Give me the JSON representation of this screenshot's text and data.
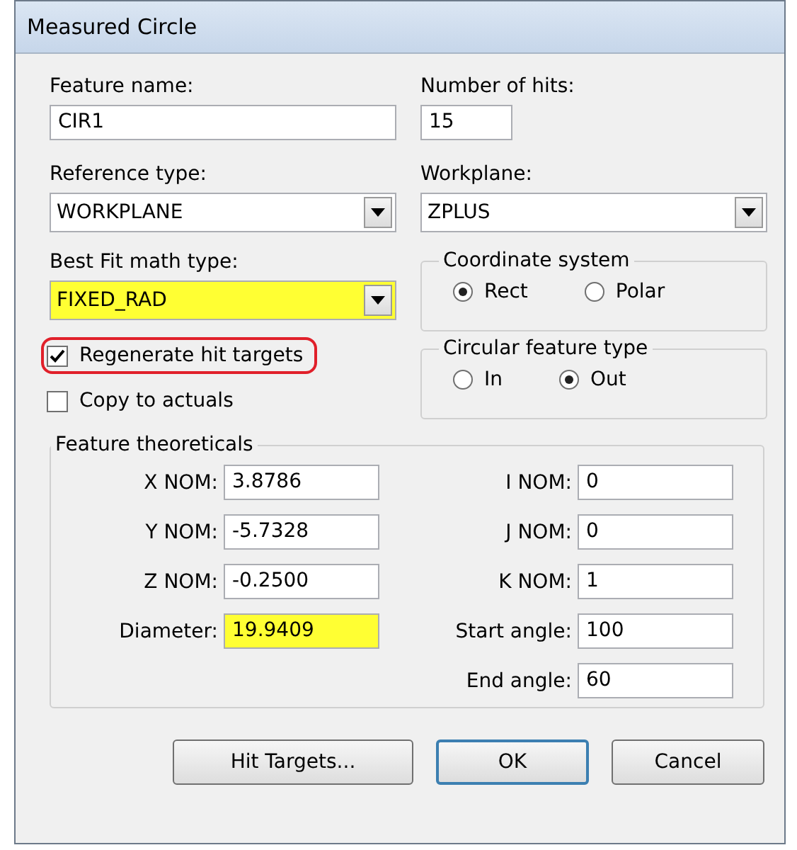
{
  "window": {
    "title": "Measured Circle"
  },
  "left_fields": [
    {
      "kind": "text",
      "label": "Feature name:",
      "value": "CIR1",
      "highlighted": false
    },
    {
      "kind": "dropdown",
      "label": "Reference type:",
      "value": "WORKPLANE",
      "highlighted": false
    },
    {
      "kind": "dropdown",
      "label": "Best Fit math type:",
      "value": "FIXED_RAD",
      "highlighted": true
    }
  ],
  "right_fields": [
    {
      "kind": "short_text",
      "label": "Number of hits:",
      "value": "15",
      "highlighted": false
    },
    {
      "kind": "dropdown",
      "label": "Workplane:",
      "value": "ZPLUS",
      "highlighted": false
    }
  ],
  "checkboxes": [
    {
      "label": "Regenerate hit targets",
      "checked": true,
      "outlined": true
    },
    {
      "label": "Copy to actuals",
      "checked": false,
      "outlined": false
    }
  ],
  "radio_groups": [
    {
      "title": "Coordinate system",
      "options": [
        {
          "label": "Rect",
          "selected": true
        },
        {
          "label": "Polar",
          "selected": false
        }
      ]
    },
    {
      "title": "Circular feature type",
      "options": [
        {
          "label": "In",
          "selected": false
        },
        {
          "label": "Out",
          "selected": true
        }
      ]
    }
  ],
  "theoreticals": {
    "title": "Feature theoreticals",
    "left": [
      {
        "label": "X NOM:",
        "value": "3.8786",
        "highlighted": false
      },
      {
        "label": "Y NOM:",
        "value": "-5.7328",
        "highlighted": false
      },
      {
        "label": "Z NOM:",
        "value": "-0.2500",
        "highlighted": false
      },
      {
        "label": "Diameter:",
        "value": "19.9409",
        "highlighted": true
      }
    ],
    "right": [
      {
        "label": "I NOM:",
        "value": "0",
        "highlighted": false
      },
      {
        "label": "J NOM:",
        "value": "0",
        "highlighted": false
      },
      {
        "label": "K NOM:",
        "value": "1",
        "highlighted": false
      },
      {
        "label": "Start angle:",
        "value": "100",
        "highlighted": false
      },
      {
        "label": "End angle:",
        "value": "60",
        "highlighted": false
      }
    ]
  },
  "buttons": [
    {
      "label": "Hit Targets...",
      "default": false
    },
    {
      "label": "OK",
      "default": true
    },
    {
      "label": "Cancel",
      "default": false
    }
  ]
}
